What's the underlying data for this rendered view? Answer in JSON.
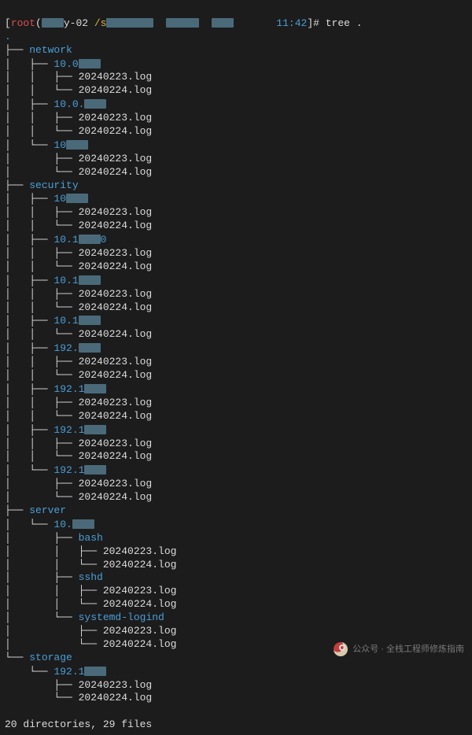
{
  "prompt": {
    "open": "[",
    "user": "root",
    "at_host": "@",
    "host_prefix": "",
    "host_visible": "y-02",
    "sep": " ",
    "path_start": "/s",
    "time": "11:42",
    "close": "]# ",
    "command": "tree ."
  },
  "cwd_dot": ".",
  "tree": {
    "network": {
      "name": "network",
      "children": [
        {
          "dir": "10.0",
          "files": [
            "20240223.log",
            "20240224.log"
          ]
        },
        {
          "dir": "10.0.",
          "files": [
            "20240223.log",
            "20240224.log"
          ]
        },
        {
          "dir": "10",
          "files": [
            "20240223.log",
            "20240224.log"
          ]
        }
      ]
    },
    "security": {
      "name": "security",
      "children": [
        {
          "dir": "10",
          "files": [
            "20240223.log",
            "20240224.log"
          ]
        },
        {
          "dir": "10.1",
          "tail": "0",
          "files": [
            "20240223.log",
            "20240224.log"
          ]
        },
        {
          "dir": "10.1",
          "files": [
            "20240223.log",
            "20240224.log"
          ]
        },
        {
          "dir": "10.1",
          "files": [
            "20240224.log"
          ]
        },
        {
          "dir": "192.",
          "files": [
            "20240223.log",
            "20240224.log"
          ]
        },
        {
          "dir": "192.1",
          "files": [
            "20240223.log",
            "20240224.log"
          ]
        },
        {
          "dir": "192.1",
          "files": [
            "20240223.log",
            "20240224.log"
          ]
        },
        {
          "dir": "192.1",
          "files": [
            "20240223.log",
            "20240224.log"
          ]
        }
      ]
    },
    "server": {
      "name": "server",
      "children": [
        {
          "dir": "10.",
          "subdirs": [
            {
              "name": "bash",
              "files": [
                "20240223.log",
                "20240224.log"
              ]
            },
            {
              "name": "sshd",
              "files": [
                "20240223.log",
                "20240224.log"
              ]
            },
            {
              "name": "systemd-logind",
              "files": [
                "20240223.log",
                "20240224.log"
              ]
            }
          ]
        }
      ]
    },
    "storage": {
      "name": "storage",
      "children": [
        {
          "dir": "192.1",
          "files": [
            "20240223.log",
            "20240224.log"
          ]
        }
      ]
    }
  },
  "summary": "20 directories, 29 files",
  "watermark": "公众号 · 全栈工程师修炼指南"
}
